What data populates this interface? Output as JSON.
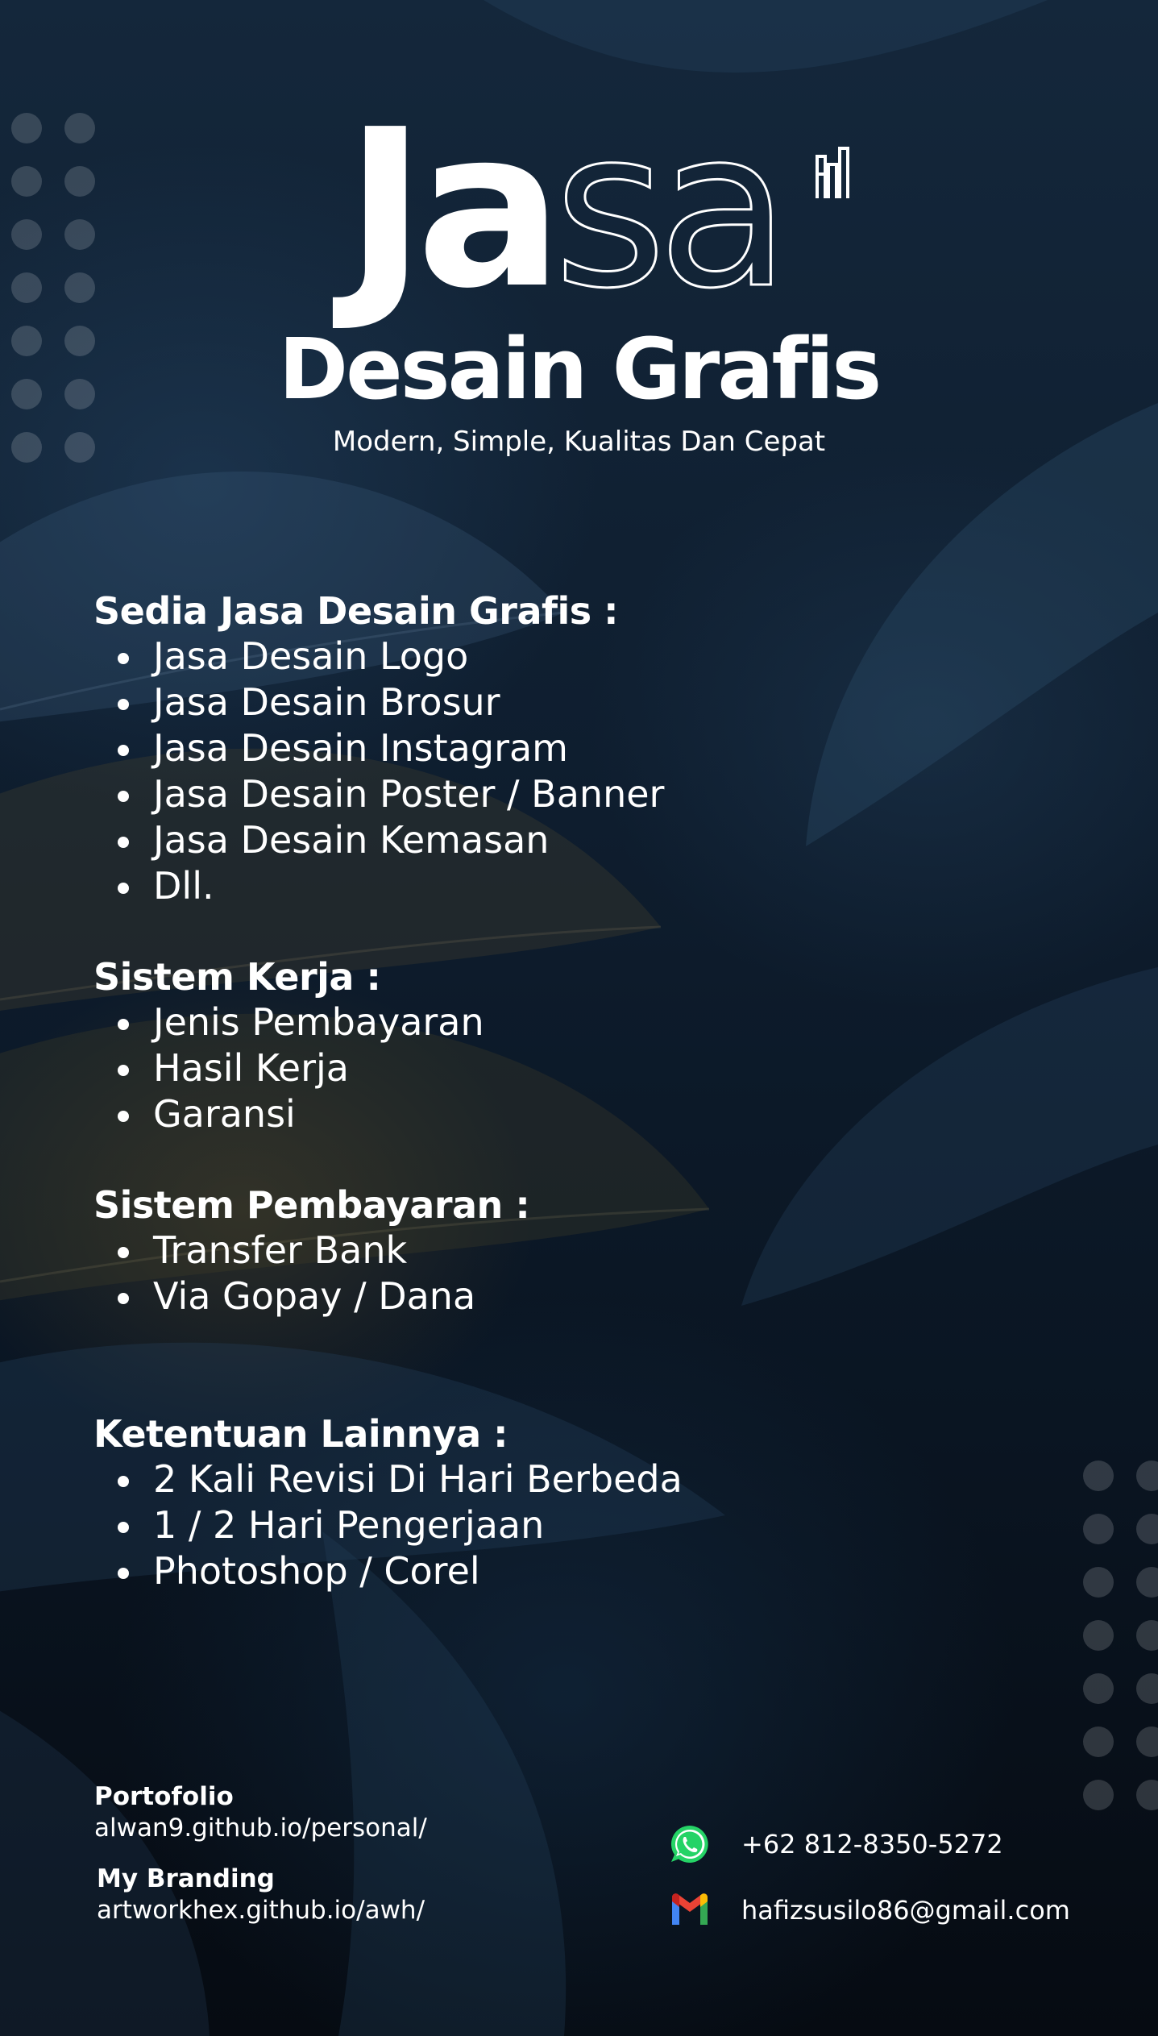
{
  "hero": {
    "title_solid": "Ja",
    "title_outline": "sa",
    "subtitle": "Desain Grafis",
    "tagline": "Modern, Simple, Kualitas Dan Cepat"
  },
  "sections": [
    {
      "heading": "Sedia Jasa Desain Grafis :",
      "items": [
        "Jasa Desain Logo",
        "Jasa Desain Brosur",
        "Jasa Desain Instagram",
        "Jasa Desain Poster / Banner",
        "Jasa Desain Kemasan",
        "Dll."
      ]
    },
    {
      "heading": "Sistem Kerja :",
      "items": [
        "Jenis Pembayaran",
        "Hasil Kerja",
        "Garansi"
      ]
    },
    {
      "heading": "Sistem Pembayaran :",
      "items": [
        "Transfer Bank",
        "Via Gopay / Dana"
      ]
    },
    {
      "heading": "Ketentuan Lainnya :",
      "items": [
        "2 Kali Revisi Di Hari Berbeda",
        "1 / 2 Hari Pengerjaan",
        "Photoshop / Corel"
      ]
    }
  ],
  "footer": {
    "portfolio_label": "Portofolio",
    "portfolio_url": "alwan9.github.io/personal/",
    "branding_label": "My Branding",
    "branding_url": "artworkhex.github.io/awh/",
    "phone": "+62 812-8350-5272",
    "email": "hafizsusilo86@gmail.com"
  },
  "icons": {
    "whatsapp": "whatsapp-icon",
    "gmail": "gmail-icon",
    "brand_mark": "brand-logo-icon"
  },
  "colors": {
    "background": "#0b1624",
    "text": "#ffffff",
    "whatsapp_green": "#25d366",
    "gmail_red": "#ea4335",
    "gmail_blue": "#4285f4",
    "gmail_green": "#34a853",
    "gmail_yellow": "#fbbc05"
  }
}
